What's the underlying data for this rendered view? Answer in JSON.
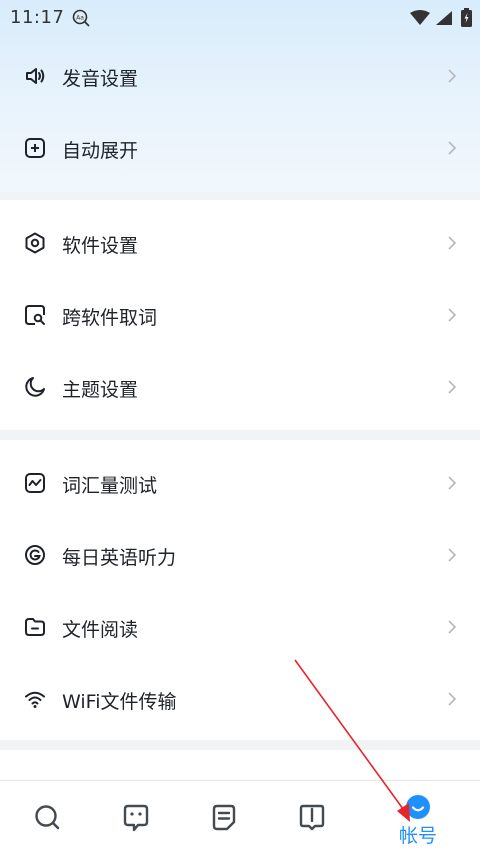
{
  "status_bar": {
    "time": "11:17"
  },
  "groups": [
    {
      "items": [
        {
          "label": "发音设置",
          "icon": "speaker-icon"
        },
        {
          "label": "自动展开",
          "icon": "plus-square-icon"
        }
      ]
    },
    {
      "items": [
        {
          "label": "软件设置",
          "icon": "hexagon-settings-icon"
        },
        {
          "label": "跨软件取词",
          "icon": "search-square-icon"
        },
        {
          "label": "主题设置",
          "icon": "moon-icon"
        }
      ]
    },
    {
      "items": [
        {
          "label": "词汇量测试",
          "icon": "chart-square-icon"
        },
        {
          "label": "每日英语听力",
          "icon": "circle-g-icon"
        },
        {
          "label": "文件阅读",
          "icon": "folder-icon"
        },
        {
          "label": "WiFi文件传输",
          "icon": "wifi-icon"
        }
      ]
    }
  ],
  "tabbar": {
    "tabs": [
      {
        "icon": "search-tab-icon"
      },
      {
        "icon": "chat-tab-icon"
      },
      {
        "icon": "notes-tab-icon"
      },
      {
        "icon": "book-tab-icon"
      },
      {
        "icon": "account-tab-icon",
        "label": "帐号",
        "active": true
      }
    ]
  },
  "colors": {
    "accent": "#1e90ff",
    "annotation": "#e8242b",
    "header_bg": "#e3f1fc"
  }
}
